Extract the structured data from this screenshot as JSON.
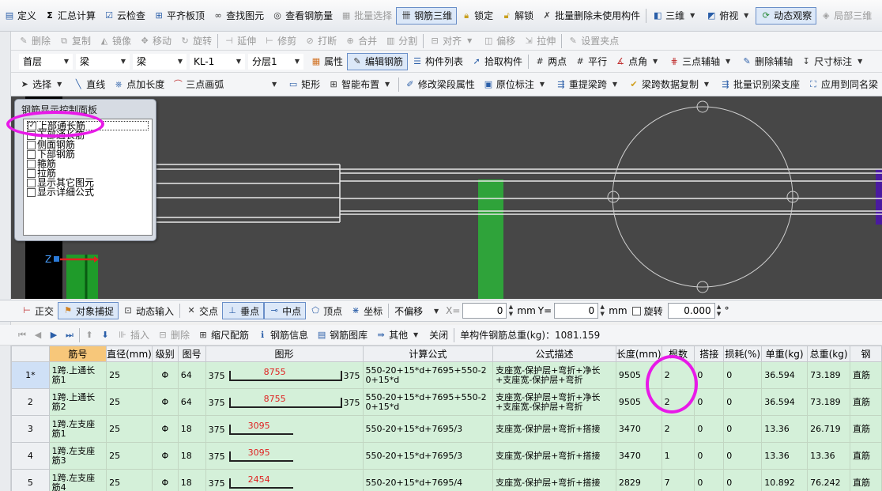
{
  "toolbar1": [
    {
      "label": "定义",
      "icon": "define-icon"
    },
    {
      "label": "汇总计算",
      "icon": "sigma-icon"
    },
    {
      "label": "云检查",
      "icon": "cloud-check-icon"
    },
    {
      "label": "平齐板顶",
      "icon": "align-slab-top-icon"
    },
    {
      "label": "查找图元",
      "icon": "binoculars-icon"
    },
    {
      "label": "查看钢筋量",
      "icon": "view-rebar-qty-icon"
    },
    {
      "label": "批量选择",
      "icon": "batch-select-icon"
    },
    {
      "label": "钢筋三维",
      "icon": "rebar-3d-icon"
    },
    {
      "label": "锁定",
      "icon": "lock-icon"
    },
    {
      "label": "解锁",
      "icon": "unlock-icon"
    },
    {
      "label": "批量删除未使用构件",
      "icon": "batch-delete-icon"
    },
    {
      "label": "三维",
      "icon": "3d-icon"
    },
    {
      "label": "俯视",
      "icon": "top-view-icon"
    },
    {
      "label": "动态观察",
      "icon": "orbit-icon"
    },
    {
      "label": "局部三维",
      "icon": "local-3d-icon"
    }
  ],
  "toolbar2": [
    "删除",
    "复制",
    "镜像",
    "移动",
    "旋转",
    "延伸",
    "修剪",
    "打断",
    "合并",
    "分割",
    "对齐",
    "偏移",
    "拉伸",
    "设置夹点"
  ],
  "toolbar3": {
    "floor": "首层",
    "type1": "梁",
    "type2": "梁",
    "component": "KL-1",
    "layer": "分层1",
    "buttons": [
      "属性",
      "编辑钢筋",
      "构件列表",
      "拾取构件",
      "两点",
      "平行",
      "点角",
      "三点辅轴",
      "删除辅轴",
      "尺寸标注"
    ]
  },
  "toolbar4": [
    "选择",
    "直线",
    "点加长度",
    "三点画弧",
    "矩形",
    "智能布置",
    "修改梁段属性",
    "原位标注",
    "重提梁跨",
    "梁跨数据复制",
    "批量识别梁支座",
    "应用到同名梁"
  ],
  "panel": {
    "title": "钢筋显示控制面板",
    "items": [
      {
        "label": "上部通长筋",
        "checked": true
      },
      {
        "label": "下部通长筋",
        "checked": false
      },
      {
        "label": "侧面钢筋",
        "checked": false
      },
      {
        "label": "下部钢筋",
        "checked": false
      },
      {
        "label": "箍筋",
        "checked": false
      },
      {
        "label": "拉筋",
        "checked": false
      },
      {
        "label": "显示其它图元",
        "checked": false
      },
      {
        "label": "显示详细公式",
        "checked": false
      }
    ]
  },
  "snapbar": {
    "ortho": "正交",
    "snap": "对象捕捉",
    "dynamic_input": "动态输入",
    "intersect": "交点",
    "perpendicular": "垂点",
    "midpoint": "中点",
    "vertex": "顶点",
    "coord": "坐标",
    "offset_mode": "不偏移",
    "x_label": "X=",
    "x_value": "0",
    "y_label": "Y=",
    "y_value": "0",
    "unit": "mm",
    "rotate_label": "旋转",
    "rotate_value": "0.000",
    "degree": "°"
  },
  "rebarbar": {
    "buttons": [
      "插入",
      "删除",
      "缩尺配筋",
      "钢筋信息",
      "钢筋图库",
      "其他",
      "关闭"
    ],
    "total_label": "单构件钢筋总重(kg)：1081.159"
  },
  "table": {
    "columns": [
      "筋号",
      "直径(mm)",
      "级别",
      "图号",
      "图形",
      "计算公式",
      "公式描述",
      "长度(mm)",
      "根数",
      "搭接",
      "损耗(%)",
      "单重(kg)",
      "总重(kg)",
      "钢"
    ],
    "rows": [
      {
        "idx": "1*",
        "name": "1跨.上通长筋1",
        "dia": "25",
        "grade": "Φ",
        "fig": "64",
        "shape": {
          "left": "375",
          "mid": "8755",
          "right": "375"
        },
        "formula": "550-20+15*d+7695+550-20+15*d",
        "desc": "支座宽-保护层+弯折+净长+支座宽-保护层+弯折",
        "length": "9505",
        "count": "2",
        "lap": "0",
        "loss": "0",
        "unit_w": "36.594",
        "total_w": "73.189",
        "type": "直筋"
      },
      {
        "idx": "2",
        "name": "1跨.上通长筋2",
        "dia": "25",
        "grade": "Φ",
        "fig": "64",
        "shape": {
          "left": "375",
          "mid": "8755",
          "right": "375"
        },
        "formula": "550-20+15*d+7695+550-20+15*d",
        "desc": "支座宽-保护层+弯折+净长+支座宽-保护层+弯折",
        "length": "9505",
        "count": "2",
        "lap": "0",
        "loss": "0",
        "unit_w": "36.594",
        "total_w": "73.189",
        "type": "直筋"
      },
      {
        "idx": "3",
        "name": "1跨.左支座筋1",
        "dia": "25",
        "grade": "Φ",
        "fig": "18",
        "shape": {
          "left": "375",
          "mid": "3095",
          "right": ""
        },
        "formula": "550-20+15*d+7695/3",
        "desc": "支座宽-保护层+弯折+搭接",
        "length": "3470",
        "count": "2",
        "lap": "0",
        "loss": "0",
        "unit_w": "13.36",
        "total_w": "26.719",
        "type": "直筋"
      },
      {
        "idx": "4",
        "name": "1跨.左支座筋3",
        "dia": "25",
        "grade": "Φ",
        "fig": "18",
        "shape": {
          "left": "375",
          "mid": "3095",
          "right": ""
        },
        "formula": "550-20+15*d+7695/3",
        "desc": "支座宽-保护层+弯折+搭接",
        "length": "3470",
        "count": "1",
        "lap": "0",
        "loss": "0",
        "unit_w": "13.36",
        "total_w": "13.36",
        "type": "直筋"
      },
      {
        "idx": "5",
        "name": "1跨.左支座筋4",
        "dia": "25",
        "grade": "Φ",
        "fig": "18",
        "shape": {
          "left": "375",
          "mid": "2454",
          "right": ""
        },
        "formula": "550-20+15*d+7695/4",
        "desc": "支座宽-保护层+弯折+搭接",
        "length": "2829",
        "count": "7",
        "lap": "0",
        "loss": "0",
        "unit_w": "10.892",
        "total_w": "76.242",
        "type": "直筋"
      }
    ]
  }
}
